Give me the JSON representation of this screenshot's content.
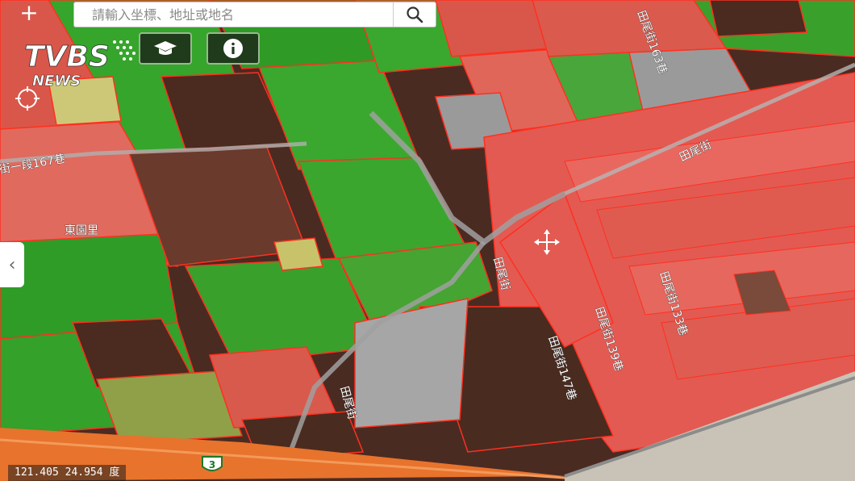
{
  "search": {
    "placeholder": "請輸入坐標、地址或地名"
  },
  "zoom": {
    "in_label": "+"
  },
  "logo": {
    "brand": "TVBS",
    "sub": "NEWS"
  },
  "map": {
    "labels": {
      "street_167": "街一段167巷",
      "dongyuan": "東園里",
      "tianwei": "田尾街",
      "tianwei_2": "田尾街",
      "tianwei_3": "田尾街",
      "tianwei_133": "田尾街133巷",
      "tianwei_139": "田尾街139巷",
      "tianwei_147": "田尾街147巷",
      "top_street": "田尾街163巷"
    },
    "route_number": "3"
  },
  "status": {
    "coords": "121.405  24.954 度"
  },
  "colors": {
    "green": "#2e9b28",
    "red": "#e2574f",
    "brown": "#4a2b1f",
    "gray": "#9a9a9a"
  }
}
